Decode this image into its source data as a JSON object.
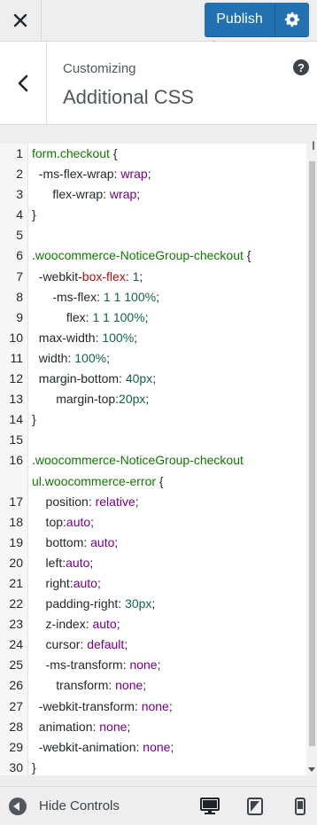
{
  "topbar": {
    "close_icon": "close-icon",
    "publish_label": "Publish",
    "settings_icon": "gear-icon",
    "publish_color": "#2271b1"
  },
  "section": {
    "subtitle": "Customizing",
    "title": "Additional CSS",
    "help_label": "?"
  },
  "editor": {
    "lines": [
      {
        "n": "1",
        "parts": [
          {
            "c": "t-sel",
            "t": "form"
          },
          {
            "c": "t-plain",
            "t": "."
          },
          {
            "c": "t-sel",
            "t": "checkout"
          },
          {
            "c": "t-plain",
            "t": " {"
          }
        ]
      },
      {
        "n": "2",
        "parts": [
          {
            "c": "t-prop",
            "t": "  -ms-flex-wrap: "
          },
          {
            "c": "t-kw",
            "t": "wrap"
          },
          {
            "c": "t-plain",
            "t": ";"
          }
        ]
      },
      {
        "n": "3",
        "parts": [
          {
            "c": "t-prop",
            "t": "      flex-wrap: "
          },
          {
            "c": "t-kw",
            "t": "wrap"
          },
          {
            "c": "t-plain",
            "t": ";"
          }
        ]
      },
      {
        "n": "4",
        "parts": [
          {
            "c": "t-plain",
            "t": "}"
          }
        ]
      },
      {
        "n": "5",
        "parts": []
      },
      {
        "n": "6",
        "parts": [
          {
            "c": "t-plain",
            "t": "."
          },
          {
            "c": "t-sel",
            "t": "woocommerce-NoticeGroup-checkout"
          },
          {
            "c": "t-plain",
            "t": " {"
          }
        ]
      },
      {
        "n": "7",
        "parts": [
          {
            "c": "t-prop",
            "t": "  -webkit-"
          },
          {
            "c": "t-vendor",
            "t": "box-flex"
          },
          {
            "c": "t-plain",
            "t": ": "
          },
          {
            "c": "t-num",
            "t": "1"
          },
          {
            "c": "t-plain",
            "t": ";"
          }
        ]
      },
      {
        "n": "8",
        "parts": [
          {
            "c": "t-prop",
            "t": "      -ms-flex: "
          },
          {
            "c": "t-num",
            "t": "1 1 100%"
          },
          {
            "c": "t-plain",
            "t": ";"
          }
        ]
      },
      {
        "n": "9",
        "parts": [
          {
            "c": "t-prop",
            "t": "          flex: "
          },
          {
            "c": "t-num",
            "t": "1 1 100%"
          },
          {
            "c": "t-plain",
            "t": ";"
          }
        ]
      },
      {
        "n": "10",
        "parts": [
          {
            "c": "t-prop",
            "t": "  max-width: "
          },
          {
            "c": "t-num",
            "t": "100%"
          },
          {
            "c": "t-plain",
            "t": ";"
          }
        ]
      },
      {
        "n": "11",
        "parts": [
          {
            "c": "t-prop",
            "t": "  width: "
          },
          {
            "c": "t-num",
            "t": "100%"
          },
          {
            "c": "t-plain",
            "t": ";"
          }
        ]
      },
      {
        "n": "12",
        "parts": [
          {
            "c": "t-prop",
            "t": "  margin-bottom: "
          },
          {
            "c": "t-num",
            "t": "40px"
          },
          {
            "c": "t-plain",
            "t": ";"
          }
        ]
      },
      {
        "n": "13",
        "parts": [
          {
            "c": "t-prop",
            "t": "       margin-top:"
          },
          {
            "c": "t-num",
            "t": "20px"
          },
          {
            "c": "t-plain",
            "t": ";"
          }
        ]
      },
      {
        "n": "14",
        "parts": [
          {
            "c": "t-plain",
            "t": "}"
          }
        ]
      },
      {
        "n": "15",
        "parts": []
      },
      {
        "n": "16",
        "parts": [
          {
            "c": "t-plain",
            "t": "."
          },
          {
            "c": "t-sel",
            "t": "woocommerce-NoticeGroup-checkout"
          }
        ]
      },
      {
        "n": "",
        "parts": [
          {
            "c": "t-sel",
            "t": "ul"
          },
          {
            "c": "t-plain",
            "t": "."
          },
          {
            "c": "t-sel",
            "t": "woocommerce-error"
          },
          {
            "c": "t-plain",
            "t": " {"
          }
        ]
      },
      {
        "n": "17",
        "parts": [
          {
            "c": "t-prop",
            "t": "    position: "
          },
          {
            "c": "t-kw",
            "t": "relative"
          },
          {
            "c": "t-plain",
            "t": ";"
          }
        ]
      },
      {
        "n": "18",
        "parts": [
          {
            "c": "t-prop",
            "t": "    top:"
          },
          {
            "c": "t-kw",
            "t": "auto"
          },
          {
            "c": "t-plain",
            "t": ";"
          }
        ]
      },
      {
        "n": "19",
        "parts": [
          {
            "c": "t-prop",
            "t": "    bottom: "
          },
          {
            "c": "t-kw",
            "t": "auto"
          },
          {
            "c": "t-plain",
            "t": ";"
          }
        ]
      },
      {
        "n": "20",
        "parts": [
          {
            "c": "t-prop",
            "t": "    left:"
          },
          {
            "c": "t-kw",
            "t": "auto"
          },
          {
            "c": "t-plain",
            "t": ";"
          }
        ]
      },
      {
        "n": "21",
        "parts": [
          {
            "c": "t-prop",
            "t": "    right:"
          },
          {
            "c": "t-kw",
            "t": "auto"
          },
          {
            "c": "t-plain",
            "t": ";"
          }
        ]
      },
      {
        "n": "22",
        "parts": [
          {
            "c": "t-prop",
            "t": "    padding-right: "
          },
          {
            "c": "t-num",
            "t": "30px"
          },
          {
            "c": "t-plain",
            "t": ";"
          }
        ]
      },
      {
        "n": "23",
        "parts": [
          {
            "c": "t-prop",
            "t": "    z-index: "
          },
          {
            "c": "t-kw",
            "t": "auto"
          },
          {
            "c": "t-plain",
            "t": ";"
          }
        ]
      },
      {
        "n": "24",
        "parts": [
          {
            "c": "t-prop",
            "t": "    cursor: "
          },
          {
            "c": "t-kw",
            "t": "default"
          },
          {
            "c": "t-plain",
            "t": ";"
          }
        ]
      },
      {
        "n": "25",
        "parts": [
          {
            "c": "t-prop",
            "t": "    -ms-transform: "
          },
          {
            "c": "t-kw",
            "t": "none"
          },
          {
            "c": "t-plain",
            "t": ";"
          }
        ]
      },
      {
        "n": "26",
        "parts": [
          {
            "c": "t-prop",
            "t": "       transform: "
          },
          {
            "c": "t-kw",
            "t": "none"
          },
          {
            "c": "t-plain",
            "t": ";"
          }
        ]
      },
      {
        "n": "27",
        "parts": [
          {
            "c": "t-prop",
            "t": "  -webkit-transform: "
          },
          {
            "c": "t-kw",
            "t": "none"
          },
          {
            "c": "t-plain",
            "t": ";"
          }
        ]
      },
      {
        "n": "28",
        "parts": [
          {
            "c": "t-prop",
            "t": "  animation: "
          },
          {
            "c": "t-kw",
            "t": "none"
          },
          {
            "c": "t-plain",
            "t": ";"
          }
        ]
      },
      {
        "n": "29",
        "parts": [
          {
            "c": "t-prop",
            "t": "  -webkit-animation: "
          },
          {
            "c": "t-kw",
            "t": "none"
          },
          {
            "c": "t-plain",
            "t": ";"
          }
        ]
      },
      {
        "n": "30",
        "parts": [
          {
            "c": "t-plain",
            "t": "}"
          }
        ]
      }
    ]
  },
  "footer": {
    "hide_label": "Hide Controls",
    "devices": [
      "desktop-icon",
      "tablet-icon",
      "mobile-icon"
    ]
  }
}
